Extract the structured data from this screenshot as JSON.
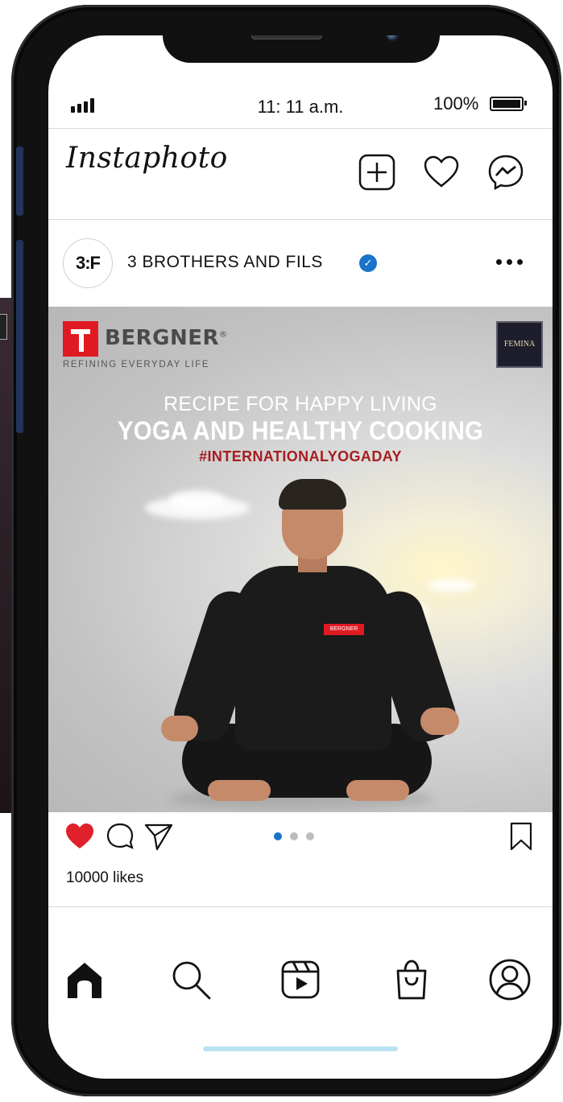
{
  "status_bar": {
    "time": "11: 11 a.m.",
    "battery": "100%"
  },
  "header": {
    "app_name": "Instaphoto",
    "icons": [
      "add-post-icon",
      "heart-icon",
      "messenger-icon"
    ]
  },
  "post": {
    "avatar_text": "3:F",
    "username": "3 BROTHERS AND FILS",
    "verified": true,
    "image": {
      "brand_name": "BERGNER",
      "brand_registered": "®",
      "brand_tagline": "REFINING EVERYDAY LIFE",
      "badge_text": "FEMINA",
      "line1": "RECIPE FOR HAPPY LIVING",
      "line2": "YOGA AND HEALTHY COOKING",
      "line3": "#INTERNATIONALYOGADAY",
      "shirt_logo": "BERGNER"
    },
    "liked": true,
    "carousel": {
      "total": 3,
      "current": 1
    },
    "likes_text": "10000 likes"
  },
  "bottom_nav": [
    "home-icon",
    "search-icon",
    "reels-icon",
    "shop-icon",
    "profile-icon"
  ],
  "colors": {
    "accent_blue": "#1a73c9",
    "like_red": "#e0202a",
    "brand_red": "#e01a22",
    "headline_red": "#a51d20"
  }
}
